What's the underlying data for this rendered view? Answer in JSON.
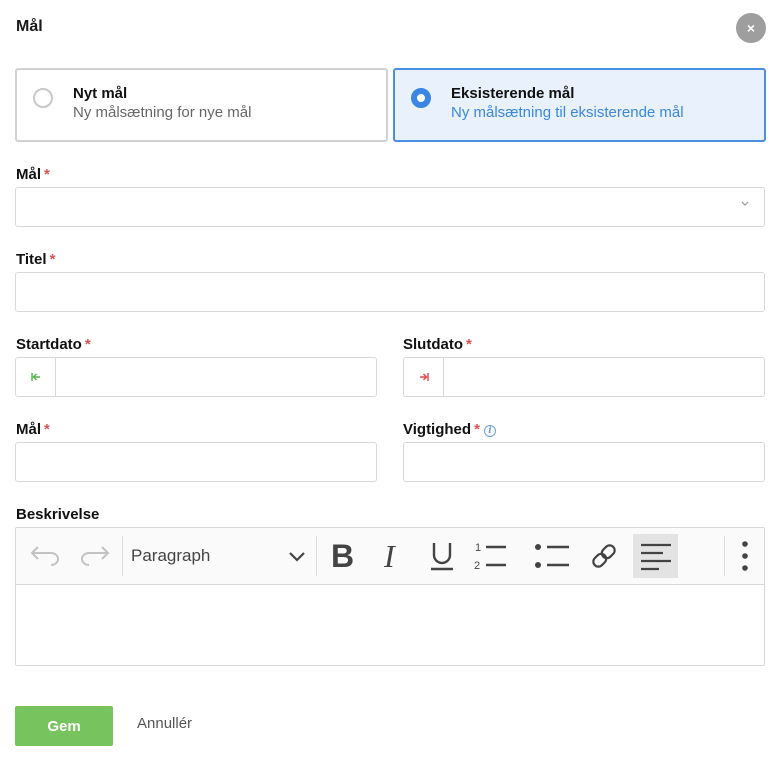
{
  "dialog": {
    "title": "Mål",
    "close_label": "×"
  },
  "options": [
    {
      "title": "Nyt mål",
      "subtitle": "Ny målsætning for nye mål",
      "selected": false
    },
    {
      "title": "Eksisterende mål",
      "subtitle": "Ny målsætning til eksisterende mål",
      "selected": true
    }
  ],
  "fields": {
    "goal_select": {
      "label": "Mål",
      "required": "*",
      "value": ""
    },
    "title": {
      "label": "Titel",
      "required": "*",
      "value": ""
    },
    "start_date": {
      "label": "Startdato",
      "required": "*",
      "value": "",
      "icon": "arrow-to-start-icon"
    },
    "end_date": {
      "label": "Slutdato",
      "required": "*",
      "value": "",
      "icon": "arrow-to-end-icon"
    },
    "target": {
      "label": "Mål",
      "required": "*",
      "value": ""
    },
    "importance": {
      "label": "Vigtighed",
      "required": "*",
      "value": "",
      "info_icon": "i"
    },
    "description": {
      "label": "Beskrivelse",
      "value": ""
    }
  },
  "editor": {
    "block_style": "Paragraph",
    "toolbar_icons": [
      "undo-icon",
      "redo-icon",
      "bold-icon",
      "italic-icon",
      "underline-icon",
      "numbered-list-icon",
      "bulleted-list-icon",
      "link-icon",
      "align-left-icon",
      "more-icon"
    ]
  },
  "actions": {
    "save_label": "Gem",
    "cancel_label": "Annullér"
  },
  "colors": {
    "accent": "#3b86e3",
    "save": "#77c45f",
    "required": "#d9534f",
    "start": "#4fb04f",
    "end": "#e04848"
  }
}
